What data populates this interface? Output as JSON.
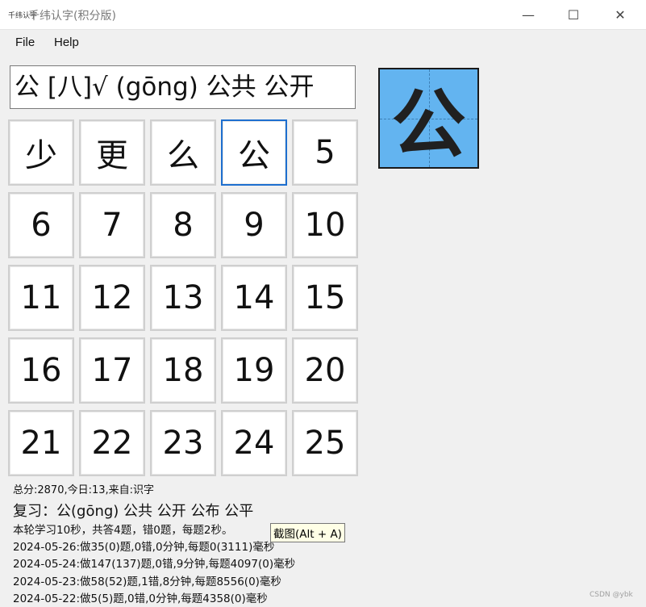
{
  "window": {
    "icon_text": "千纬认字",
    "title": "千纬认字(积分版)",
    "minimize_glyph": "—",
    "maximize_glyph": "☐",
    "close_glyph": "✕"
  },
  "menu": {
    "file_label": "File",
    "help_label": "Help"
  },
  "prompt": {
    "text": "公 [八]√ (gōng) 公共 公开"
  },
  "preview": {
    "character": "公",
    "background_color": "#63b4f0"
  },
  "grid": {
    "cells": [
      "少",
      "更",
      "么",
      "公",
      "5",
      "6",
      "7",
      "8",
      "9",
      "10",
      "11",
      "12",
      "13",
      "14",
      "15",
      "16",
      "17",
      "18",
      "19",
      "20",
      "21",
      "22",
      "23",
      "24",
      "25"
    ],
    "selected_index": 3
  },
  "stats": {
    "summary": "总分:2870,今日:13,来自:识字",
    "review": "复习：公(gōng) 公共 公开 公布 公平",
    "session": "本轮学习10秒，共答4题，错0题，每题2秒。",
    "history": [
      "2024-05-26:做35(0)题,0错,0分钟,每题0(3111)毫秒",
      "2024-05-24:做147(137)题,0错,9分钟,每题4097(0)毫秒",
      "2024-05-23:做58(52)题,1错,8分钟,每题8556(0)毫秒",
      "2024-05-22:做5(5)题,0错,0分钟,每题4358(0)毫秒"
    ]
  },
  "tooltip": {
    "text": "截图(Alt + A)"
  },
  "watermark": {
    "text": "CSDN @ybk"
  }
}
